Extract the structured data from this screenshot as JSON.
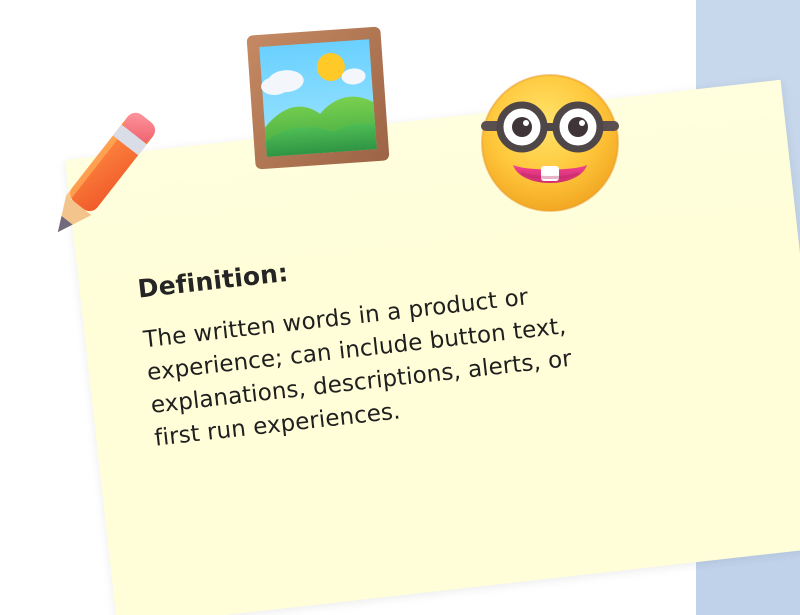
{
  "icons": {
    "pencil": "pencil-icon",
    "picture": "framed-picture-icon",
    "face": "nerd-face-icon"
  },
  "note": {
    "title": "Definition:",
    "body_lines": [
      "The written words in a product or",
      "experience; can include button text,",
      "explanations, descriptions, alerts, or",
      "first run experiences."
    ],
    "background_color": "#fffed8"
  },
  "panel": {
    "background_color": "#c8d8ec"
  }
}
